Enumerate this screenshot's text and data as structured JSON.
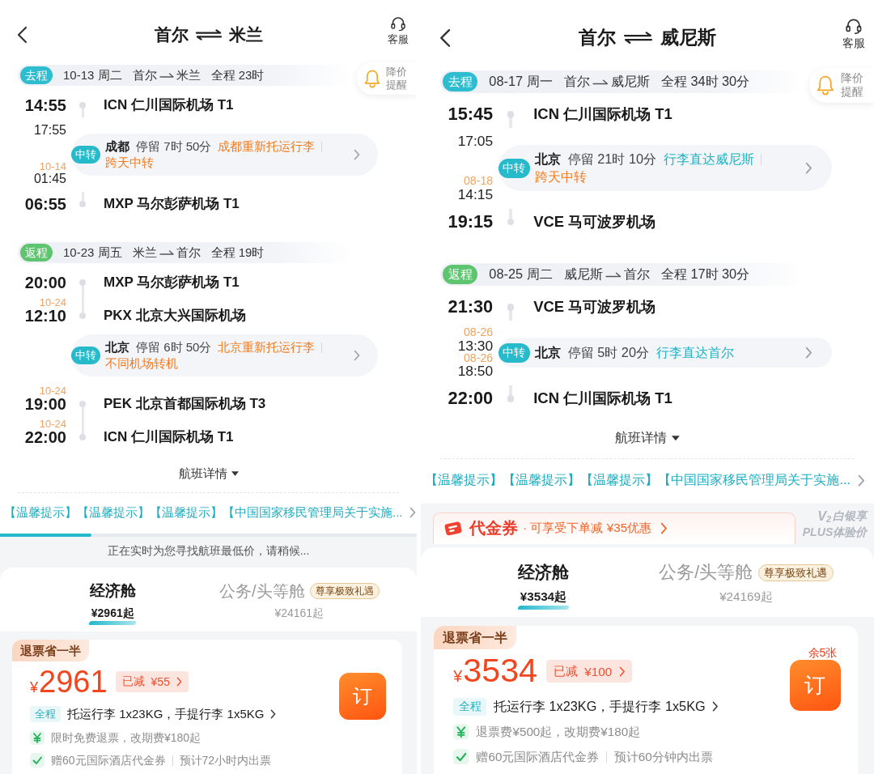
{
  "panels": [
    {
      "header": {
        "origin": "首尔",
        "destination": "米兰",
        "service": "客服"
      },
      "price_alert": "降价提醒",
      "legs": [
        {
          "tag": "去程",
          "color": "#2dbdcf",
          "date": "10-13 周二",
          "origin": "首尔",
          "destination": "米兰",
          "duration": "全程 23时",
          "stops": [
            {
              "kind": "airport",
              "time": "14:55",
              "airport": "ICN 仁川国际机场 T1"
            },
            {
              "kind": "transfer",
              "arrive_time": "17:55",
              "depart_date": "10-14",
              "depart_time": "01:45",
              "badge": "中转",
              "city": "成都",
              "stay": "停留 7时 50分",
              "notes": [
                {
                  "text": "成都重新托运行李",
                  "color": "#f47b20"
                },
                {
                  "text": "跨天中转",
                  "color": "#f47b20"
                }
              ]
            },
            {
              "kind": "airport",
              "time": "06:55",
              "airport": "MXP 马尔彭萨机场 T1"
            }
          ]
        },
        {
          "tag": "返程",
          "color": "#5ec46f",
          "date": "10-23 周五",
          "origin": "米兰",
          "destination": "首尔",
          "duration": "全程 19时",
          "stops": [
            {
              "kind": "airport",
              "time": "20:00",
              "airport": "MXP 马尔彭萨机场 T1"
            },
            {
              "kind": "airport",
              "date": "10-24",
              "time": "12:10",
              "airport": "PKX 北京大兴国际机场"
            },
            {
              "kind": "transfer",
              "badge": "中转",
              "city": "北京",
              "stay": "停留 6时 50分",
              "notes": [
                {
                  "text": "北京重新托运行李",
                  "color": "#f47b20"
                },
                {
                  "text": "不同机场转机",
                  "color": "#f47b20"
                }
              ]
            },
            {
              "kind": "airport",
              "date": "10-24",
              "time": "19:00",
              "airport": "PEK 北京首都国际机场 T3"
            },
            {
              "kind": "airport",
              "date": "10-24",
              "time": "22:00",
              "airport": "ICN 仁川国际机场 T1"
            }
          ]
        }
      ],
      "details_toggle": "航班详情",
      "notice": "【温馨提示】【温馨提示】【温馨提示】【中国国家移民管理局关于实施...",
      "banner": {
        "kind": "loading",
        "level": 0.22,
        "text": "正在实时为您寻找航班最低价，请稍候..."
      },
      "cabins": [
        {
          "name": "经济舱",
          "price": "¥2961起",
          "selected": true
        },
        {
          "name": "公务/头等舱",
          "price": "¥24161起",
          "selected": false,
          "badge": "尊享极致礼遇"
        }
      ],
      "fare": {
        "tag": "退票省一半",
        "currency": "¥",
        "price": "2961",
        "discount_label": "已减",
        "discount": "¥55",
        "book": "订",
        "baggage_tag": "全程",
        "baggage": "托运行李 1x23KG，手提行李 1x5KG",
        "perks": [
          {
            "kind": "fee",
            "text": "限时免费退票，改期费¥180起"
          },
          {
            "kind": "gift",
            "text": "赠60元国际酒店代金券",
            "extra": "预计72小时内出票"
          }
        ]
      }
    },
    {
      "header": {
        "origin": "首尔",
        "destination": "威尼斯",
        "service": "客服"
      },
      "price_alert": "降价提醒",
      "legs": [
        {
          "tag": "去程",
          "color": "#2dbdcf",
          "date": "08-17 周一",
          "origin": "首尔",
          "destination": "威尼斯",
          "duration": "全程 34时 30分",
          "stops": [
            {
              "kind": "airport",
              "time": "15:45",
              "airport": "ICN 仁川国际机场 T1"
            },
            {
              "kind": "transfer",
              "arrive_time": "17:05",
              "depart_date": "08-18",
              "depart_time": "14:15",
              "badge": "中转",
              "city": "北京",
              "stay": "停留 21时 10分",
              "notes": [
                {
                  "text": "行李直达威尼斯",
                  "color": "#1db3c5"
                },
                {
                  "text": "跨天中转",
                  "color": "#f47b20"
                }
              ]
            },
            {
              "kind": "airport",
              "time": "19:15",
              "airport": "VCE 马可波罗机场"
            }
          ]
        },
        {
          "tag": "返程",
          "color": "#5ec46f",
          "date": "08-25 周二",
          "origin": "威尼斯",
          "destination": "首尔",
          "duration": "全程 17时 30分",
          "stops": [
            {
              "kind": "airport",
              "time": "21:30",
              "airport": "VCE 马可波罗机场"
            },
            {
              "kind": "transfer",
              "arrive_date": "08-26",
              "arrive_time": "13:30",
              "depart_date": "08-26",
              "depart_time": "18:50",
              "badge": "中转",
              "city": "北京",
              "stay": "停留 5时 20分",
              "notes": [
                {
                  "text": "行李直达首尔",
                  "color": "#1db3c5"
                }
              ]
            },
            {
              "kind": "airport",
              "time": "22:00",
              "airport": "ICN 仁川国际机场 T1"
            }
          ]
        }
      ],
      "details_toggle": "航班详情",
      "notice": "【温馨提示】【温馨提示】【温馨提示】【中国国家移民管理局关于实施...",
      "banner": {
        "kind": "coupon",
        "title": "代金券",
        "text": "· 可享受下单减 ¥35优惠",
        "logo": "V$_{2}$",
        "member": "白银享",
        "member_price": "PLUS体验价"
      },
      "cabins": [
        {
          "name": "经济舱",
          "price": "¥3534起",
          "selected": true
        },
        {
          "name": "公务/头等舱",
          "price": "¥24169起",
          "selected": false,
          "badge": "尊享极致礼遇"
        }
      ],
      "fare": {
        "tag": "退票省一半",
        "currency": "¥",
        "price": "3534",
        "discount_label": "已减",
        "discount": "¥100",
        "stock": "余5张",
        "book": "订",
        "baggage_tag": "全程",
        "baggage": "托运行李 1x23KG，手提行李 1x5KG",
        "perks": [
          {
            "kind": "fee",
            "text": "退票费¥500起，改期费¥180起"
          },
          {
            "kind": "gift",
            "text": "赠60元国际酒店代金券",
            "extra": "预计60分钟内出票"
          }
        ]
      }
    }
  ]
}
